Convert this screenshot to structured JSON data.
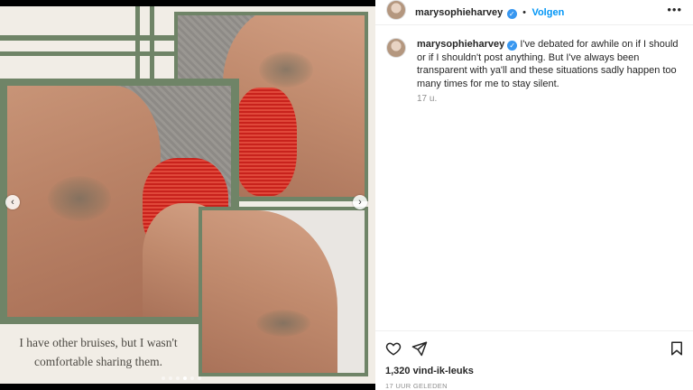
{
  "post": {
    "caption_overlay": "I have other bruises, but I wasn't comfortable sharing them.",
    "nav_prev_icon": "chevron-left-icon",
    "nav_next_icon": "chevron-right-icon",
    "slide_count": 6,
    "active_slide": 3
  },
  "header": {
    "username": "marysophieharvey",
    "separator": "•",
    "follow_label": "Volgen",
    "more_icon": "•••"
  },
  "comment": {
    "username": "marysophieharvey",
    "text": "I've debated for awhile on if I should or if I shouldn't post anything. But I've always been transparent with ya'll and these situations sadly happen too many times for me to stay silent.",
    "time": "17 u."
  },
  "footer": {
    "likes": "1,320 vind-ik-leuks",
    "posted": "17 UUR GELEDEN"
  },
  "colors": {
    "frame_green": "#6f8467",
    "background_cream": "#f1ede6",
    "follow_blue": "#0095f6",
    "verified_blue": "#3897f0"
  }
}
